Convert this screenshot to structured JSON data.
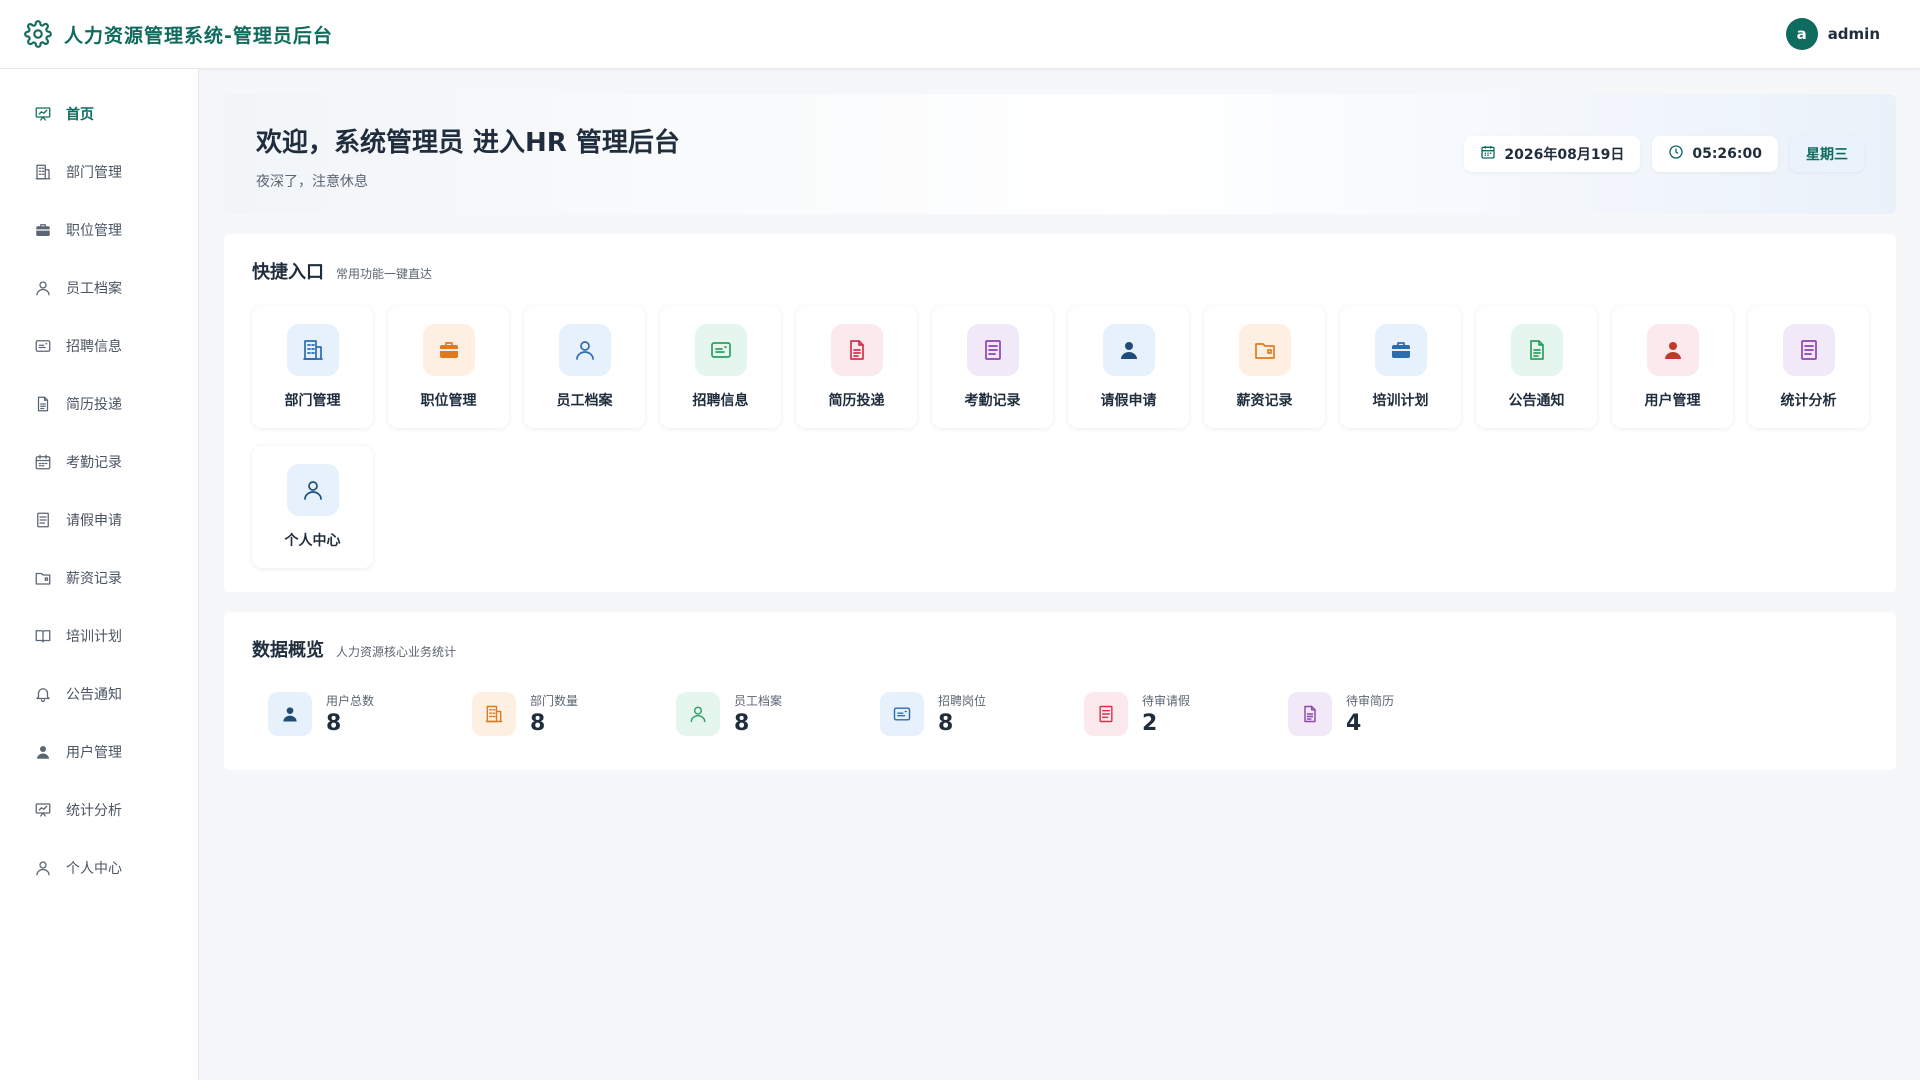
{
  "header": {
    "title": "人力资源管理系统-管理员后台",
    "user_initial": "a",
    "username": "admin",
    "brand_color": "#0f6b5d"
  },
  "sidebar": {
    "items": [
      {
        "label": "首页",
        "icon": "dashboard-icon",
        "active": true
      },
      {
        "label": "部门管理",
        "icon": "building-icon"
      },
      {
        "label": "职位管理",
        "icon": "briefcase-icon"
      },
      {
        "label": "员工档案",
        "icon": "user-icon"
      },
      {
        "label": "招聘信息",
        "icon": "id-card-icon"
      },
      {
        "label": "简历投递",
        "icon": "document-icon"
      },
      {
        "label": "考勤记录",
        "icon": "calendar-icon"
      },
      {
        "label": "请假申请",
        "icon": "form-icon"
      },
      {
        "label": "薪资记录",
        "icon": "folder-icon"
      },
      {
        "label": "培训计划",
        "icon": "book-icon"
      },
      {
        "label": "公告通知",
        "icon": "bell-icon"
      },
      {
        "label": "用户管理",
        "icon": "user-solid-icon"
      },
      {
        "label": "统计分析",
        "icon": "chart-icon"
      },
      {
        "label": "个人中心",
        "icon": "user-icon"
      }
    ]
  },
  "welcome": {
    "title": "欢迎，系统管理员 进入HR 管理后台",
    "subtitle": "夜深了，注意休息",
    "date": "2026年08月19日",
    "time": "05:26:00",
    "weekday": "星期三"
  },
  "quick": {
    "title": "快捷入口",
    "subtitle": "常用功能一键直达",
    "items": [
      {
        "label": "部门管理",
        "icon": "building-icon",
        "bg": "#e6f1fb",
        "color": "#2b6cb0"
      },
      {
        "label": "职位管理",
        "icon": "briefcase-icon",
        "bg": "#fdf0e3",
        "color": "#e07a1f"
      },
      {
        "label": "员工档案",
        "icon": "user-icon",
        "bg": "#e6f1fb",
        "color": "#2b6cb0"
      },
      {
        "label": "招聘信息",
        "icon": "id-card-icon",
        "bg": "#e5f6ee",
        "color": "#2f9e62"
      },
      {
        "label": "简历投递",
        "icon": "document-icon",
        "bg": "#fce9ee",
        "color": "#d2334b"
      },
      {
        "label": "考勤记录",
        "icon": "form-icon",
        "bg": "#f1e8f8",
        "color": "#8e44ad"
      },
      {
        "label": "请假申请",
        "icon": "user-solid-icon",
        "bg": "#e6f1fb",
        "color": "#1f4d78"
      },
      {
        "label": "薪资记录",
        "icon": "folder-icon",
        "bg": "#fdf0e3",
        "color": "#e07a1f"
      },
      {
        "label": "培训计划",
        "icon": "briefcase-solid-icon",
        "bg": "#e6f1fb",
        "color": "#2b6cb0"
      },
      {
        "label": "公告通知",
        "icon": "document-icon",
        "bg": "#e5f6ee",
        "color": "#2f9e62"
      },
      {
        "label": "用户管理",
        "icon": "user-solid-icon",
        "bg": "#fce9ee",
        "color": "#c0392b"
      },
      {
        "label": "统计分析",
        "icon": "form-icon",
        "bg": "#f1e8f8",
        "color": "#8e44ad"
      },
      {
        "label": "个人中心",
        "icon": "user-icon",
        "bg": "#e6f1fb",
        "color": "#1f4d78"
      }
    ]
  },
  "overview": {
    "title": "数据概览",
    "subtitle": "人力资源核心业务统计",
    "stats": [
      {
        "label": "用户总数",
        "value": "8",
        "icon": "user-solid-icon",
        "bg": "#e6f1fb",
        "color": "#1f4d78"
      },
      {
        "label": "部门数量",
        "value": "8",
        "icon": "building-icon",
        "bg": "#fdf0e3",
        "color": "#e07a1f"
      },
      {
        "label": "员工档案",
        "value": "8",
        "icon": "user-icon",
        "bg": "#e5f6ee",
        "color": "#2f9e62"
      },
      {
        "label": "招聘岗位",
        "value": "8",
        "icon": "id-card-icon",
        "bg": "#e6f1fb",
        "color": "#2b6cb0"
      },
      {
        "label": "待审请假",
        "value": "2",
        "icon": "form-icon",
        "bg": "#fce9ee",
        "color": "#d2334b"
      },
      {
        "label": "待审简历",
        "value": "4",
        "icon": "document-icon",
        "bg": "#f1e8f8",
        "color": "#8e44ad"
      }
    ]
  }
}
